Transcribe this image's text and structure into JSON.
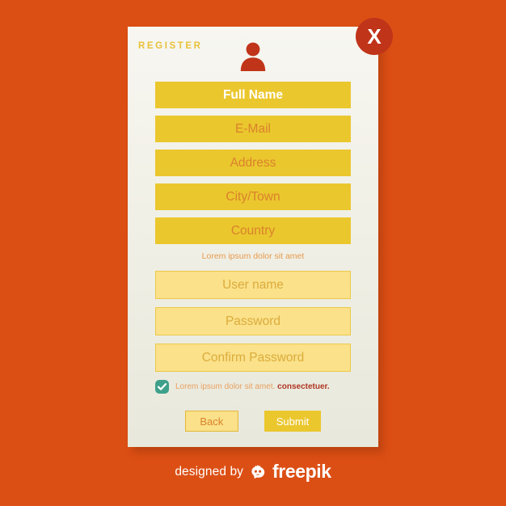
{
  "background_color": "#dc4f14",
  "card": {
    "title": "REGISTER",
    "avatar_icon": "user-avatar-icon",
    "close_icon_label": "X",
    "primary_fields": [
      {
        "label": "Full Name",
        "state": "filled"
      },
      {
        "label": "E-Mail",
        "state": "placeholder"
      },
      {
        "label": "Address",
        "state": "placeholder"
      },
      {
        "label": "City/Town",
        "state": "placeholder"
      },
      {
        "label": "Country",
        "state": "placeholder"
      }
    ],
    "separator_text": "Lorem ipsum dolor sit amet",
    "credential_fields": [
      {
        "label": "User name",
        "state": "placeholder"
      },
      {
        "label": "Password",
        "state": "placeholder"
      },
      {
        "label": "Confirm Password",
        "state": "placeholder"
      }
    ],
    "consent": {
      "checked": true,
      "text": "Lorem ipsum dolor sit amet.",
      "emphasis": "consectetuer."
    },
    "buttons": {
      "back": "Back",
      "submit": "Submit"
    },
    "colors": {
      "gold_field": "#ebc72e",
      "light_field": "#fae18a",
      "title": "#e9c13a",
      "accent_red": "#c0341a",
      "check_teal": "#3ea08a",
      "placeholder_text": "#d9822b"
    }
  },
  "footer": {
    "designed_by": "designed by",
    "brand": "freepik",
    "logo_icon": "freepik-logo-icon"
  }
}
